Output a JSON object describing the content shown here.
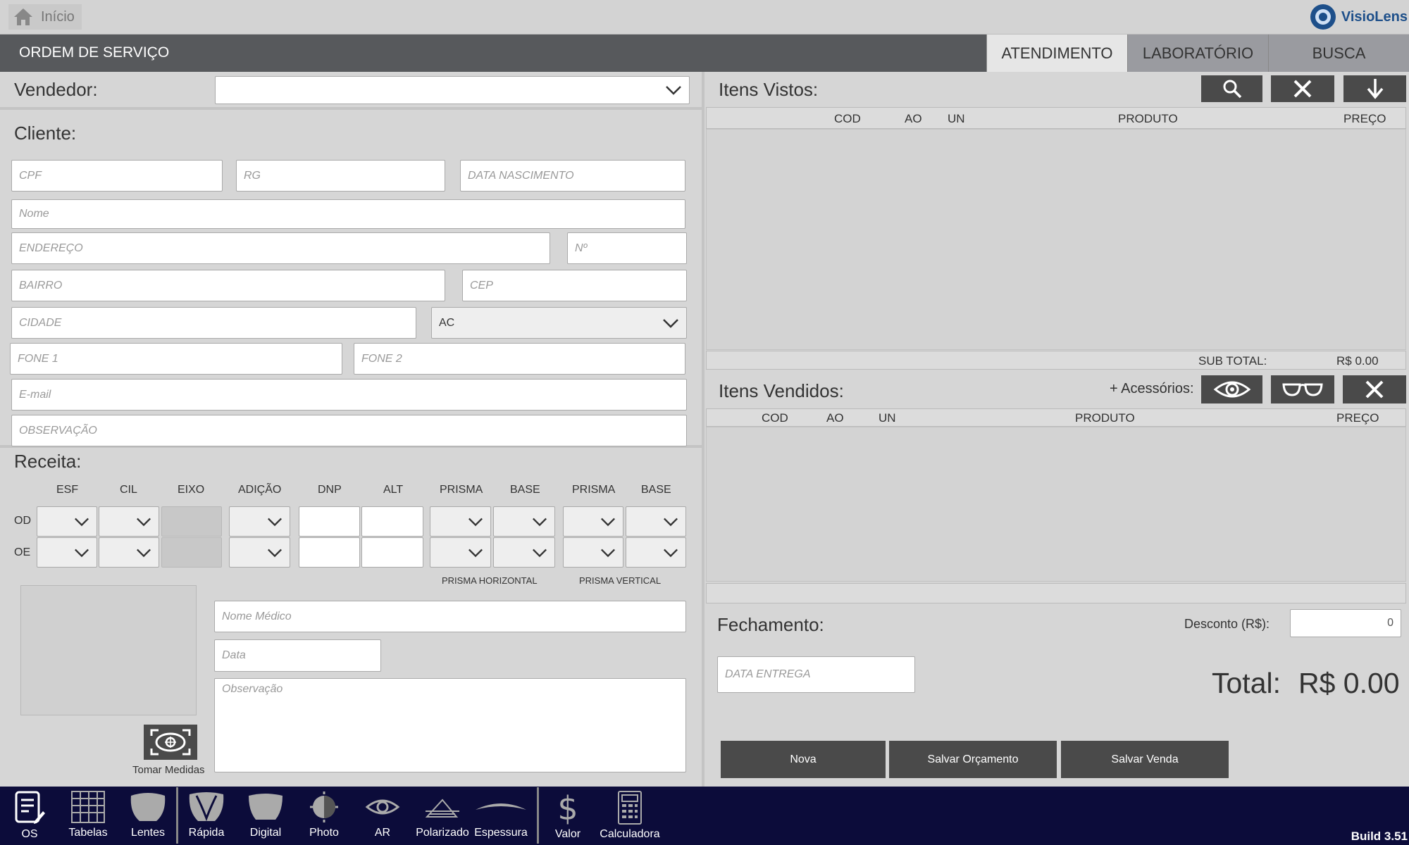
{
  "topbar": {
    "home_label": "Início",
    "brand": "VisioLens"
  },
  "header": {
    "title": "ORDEM DE SERVIÇO",
    "tabs": [
      {
        "label": "ATENDIMENTO"
      },
      {
        "label": "LABORATÓRIO"
      },
      {
        "label": "BUSCA"
      }
    ]
  },
  "vendedor": {
    "label": "Vendedor:",
    "value": ""
  },
  "cliente": {
    "label": "Cliente:",
    "cpf": "CPF",
    "rg": "RG",
    "nascimento": "DATA NASCIMENTO",
    "nome": "Nome",
    "endereco": "ENDEREÇO",
    "numero": "Nº",
    "bairro": "BAIRRO",
    "cep": "CEP",
    "cidade": "CIDADE",
    "uf": "AC",
    "fone1": "FONE 1",
    "fone2": "FONE 2",
    "email": "E-mail",
    "observacao": "OBSERVAÇÃO"
  },
  "receita": {
    "label": "Receita:",
    "cols": [
      "ESF",
      "CIL",
      "EIXO",
      "ADIÇÃO",
      "DNP",
      "ALT",
      "PRISMA",
      "BASE",
      "PRISMA",
      "BASE"
    ],
    "rows": [
      "OD",
      "OE"
    ],
    "prisma_h": "PRISMA HORIZONTAL",
    "prisma_v": "PRISMA VERTICAL",
    "medico": "Nome Médico",
    "data": "Data",
    "obs": "Observação",
    "tomar": "Tomar Medidas"
  },
  "vistos": {
    "label": "Itens Vistos:",
    "cols": [
      "COD",
      "AO",
      "UN",
      "PRODUTO",
      "PREÇO"
    ],
    "subtotal_label": "SUB TOTAL:",
    "subtotal": "R$ 0.00"
  },
  "vendidos": {
    "label": "Itens Vendidos:",
    "acessorios": "+ Acessórios:",
    "cols": [
      "COD",
      "AO",
      "UN",
      "PRODUTO",
      "PREÇO"
    ]
  },
  "fechamento": {
    "label": "Fechamento:",
    "desconto_label": "Desconto (R$):",
    "desconto": "0",
    "entrega": "DATA ENTREGA",
    "total_label": "Total:",
    "total": "R$ 0.00",
    "buttons": [
      "Nova",
      "Salvar Orçamento",
      "Salvar Venda"
    ]
  },
  "bottom": {
    "items": [
      "OS",
      "Tabelas",
      "Lentes",
      "Rápida",
      "Digital",
      "Photo",
      "AR",
      "Polarizado",
      "Espessura",
      "Valor",
      "Calculadora"
    ],
    "build": "Build 3.51"
  }
}
